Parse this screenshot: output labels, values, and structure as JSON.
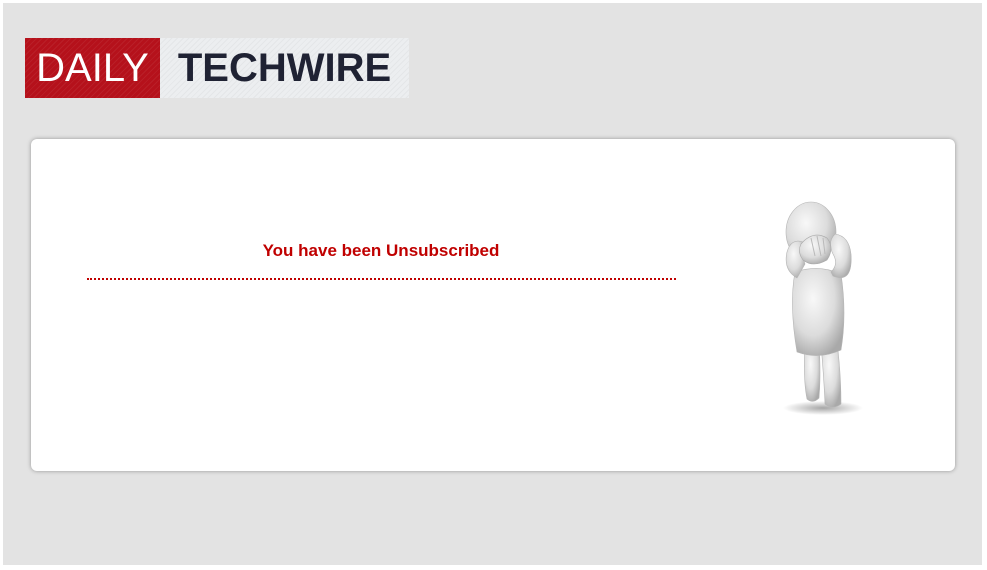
{
  "brand": {
    "logo_word_1": "DAILY",
    "logo_word_2": "TECHWIRE",
    "accent_color": "#b5111b",
    "dark_color": "#1f2233"
  },
  "message": {
    "text": "You have been Unsubscribed",
    "color": "#c00000"
  },
  "illustration": {
    "icon": "sad-person-facepalm-icon"
  }
}
